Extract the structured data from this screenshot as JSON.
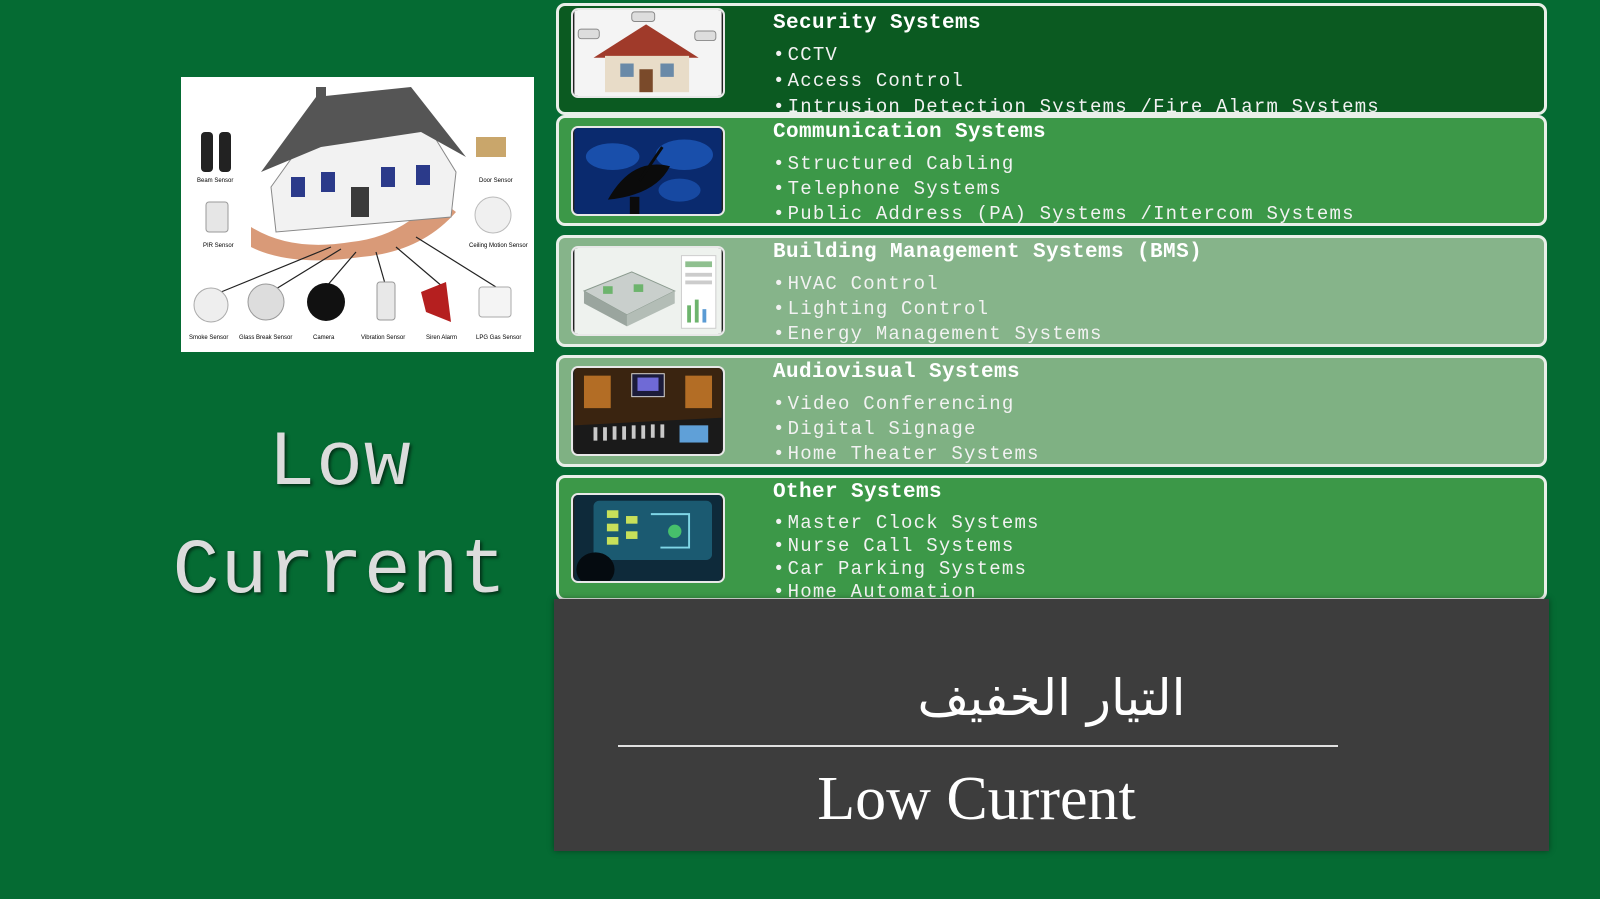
{
  "left": {
    "title_line1": "Low",
    "title_line2": "Current",
    "image": {
      "labels": [
        "Beam Sensor",
        "Door Sensor",
        "PIR Sensor",
        "Ceiling Motion Sensor",
        "Smoke Sensor",
        "Glass Break Sensor",
        "Camera",
        "Vibration Sensor",
        "Siren Alarm",
        "LPG Gas Sensor"
      ]
    }
  },
  "panels": [
    {
      "title": "Security Systems",
      "icon": "house-cctv-icon",
      "items": [
        "CCTV",
        "Access Control",
        "Intrusion Detection Systems /Fire Alarm Systems"
      ]
    },
    {
      "title": "Communication Systems",
      "icon": "satellite-dish-icon",
      "items": [
        "Structured Cabling",
        "Telephone Systems",
        "Public Address (PA) Systems /Intercom Systems"
      ]
    },
    {
      "title": "Building Management Systems (BMS)",
      "icon": "building-dashboard-icon",
      "items": [
        "HVAC Control",
        "Lighting Control",
        "Energy Management Systems"
      ]
    },
    {
      "title": "Audiovisual Systems",
      "icon": "studio-console-icon",
      "items": [
        "Video Conferencing",
        "Digital Signage",
        "Home Theater Systems"
      ]
    },
    {
      "title": "Other Systems",
      "icon": "control-screen-icon",
      "items": [
        "Master Clock Systems",
        "Nurse Call Systems",
        "Car Parking Systems",
        "Home Automation"
      ]
    }
  ],
  "bottom": {
    "arabic_title": "التيار الخفيف",
    "english_title": "Low Current"
  },
  "colors": {
    "background": "#056b33",
    "panel1": "#0b5a21",
    "panel2": "#3c9848",
    "panel3": "#86b48a",
    "panel4": "#7fb183",
    "panel5": "#3c9848",
    "bottom_card": "#3d3d3d"
  }
}
